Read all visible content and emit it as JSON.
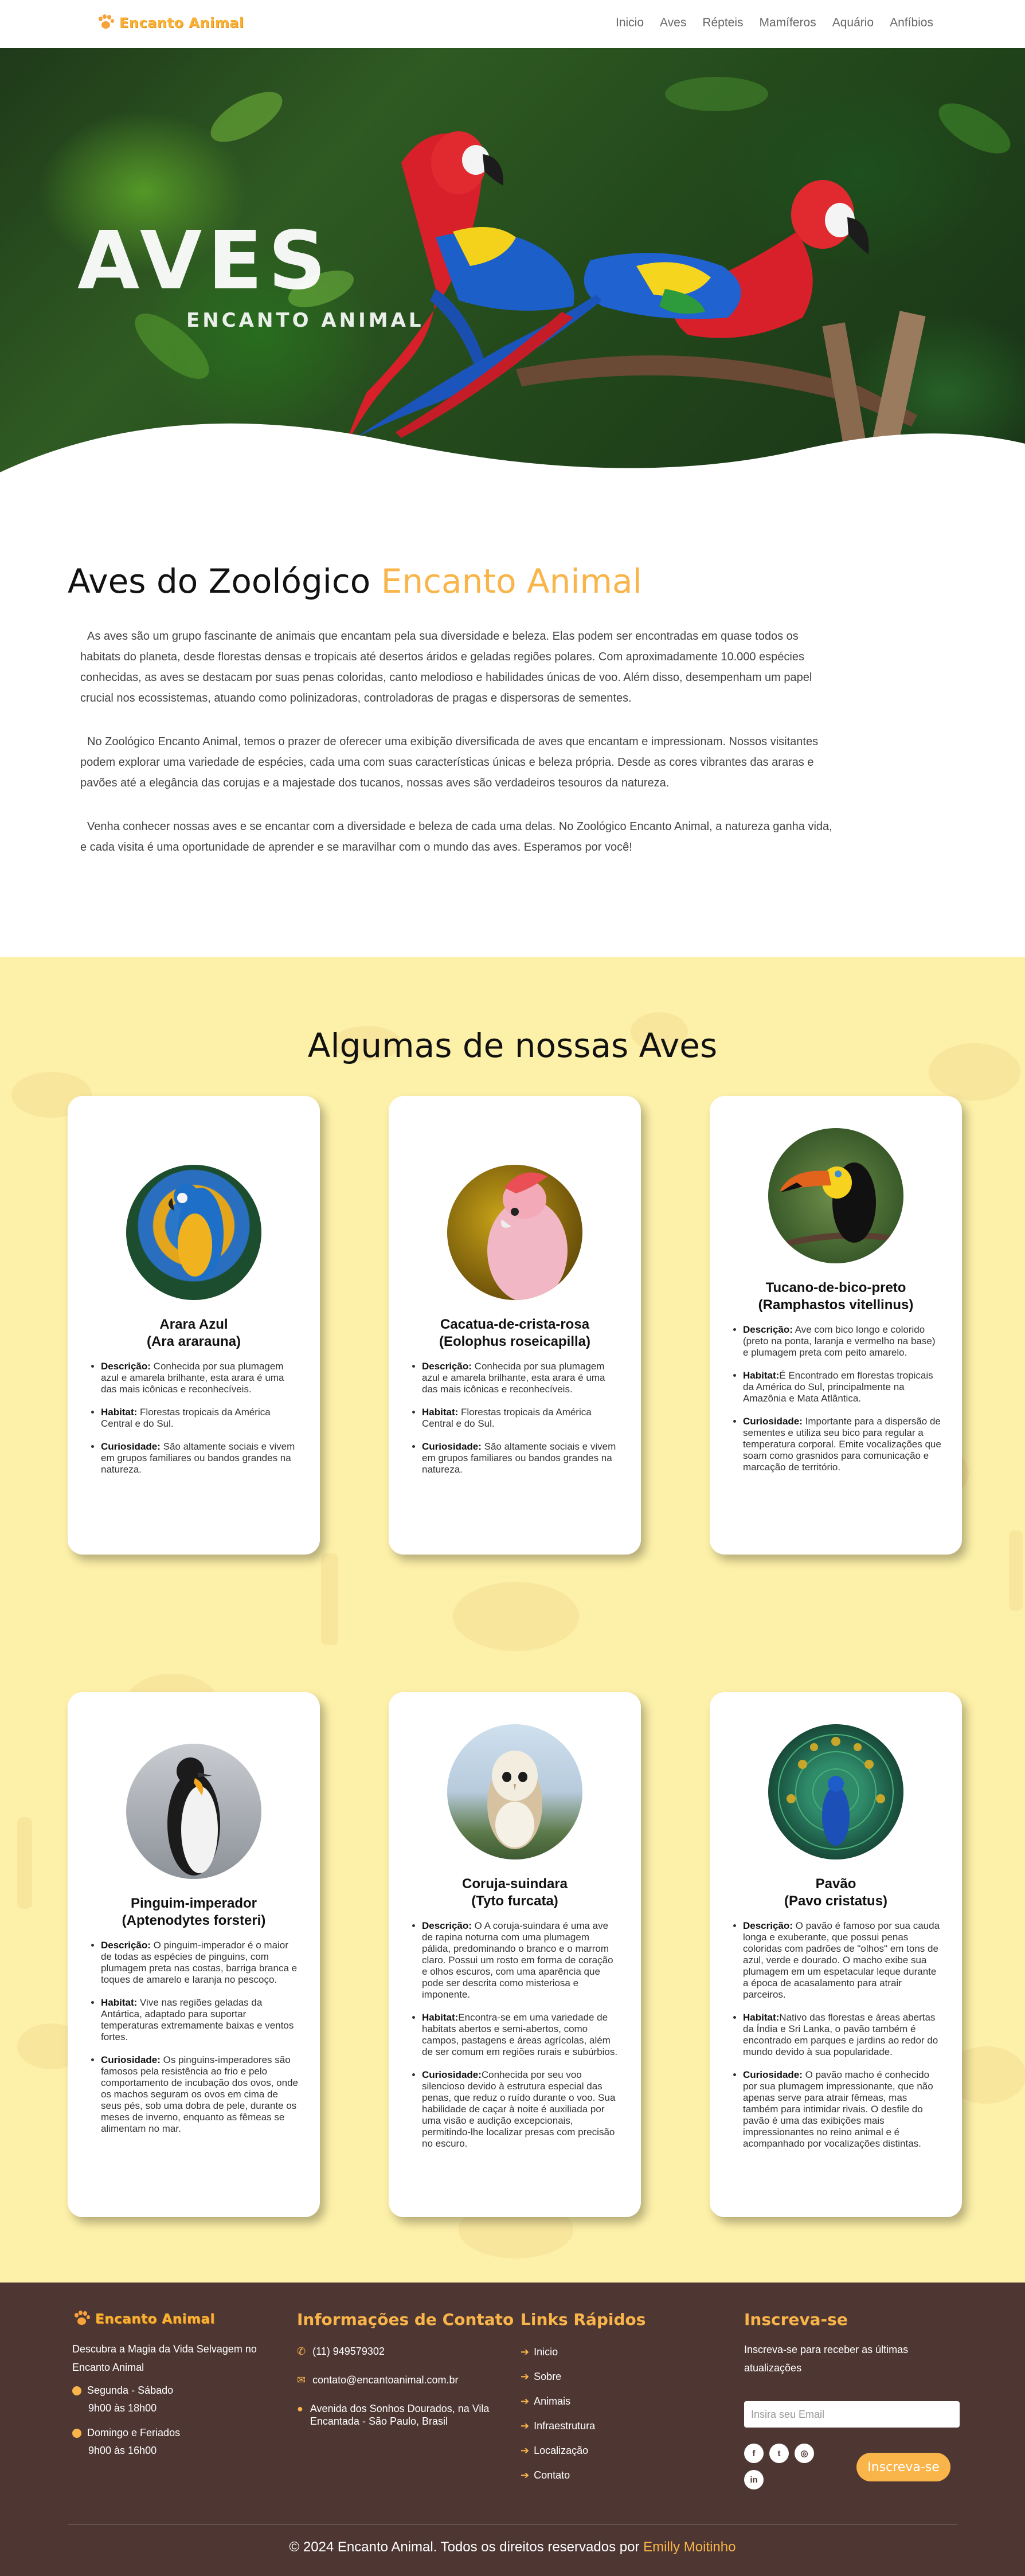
{
  "nav": {
    "brand": "Encanto Animal",
    "links": [
      "Inicio",
      "Aves",
      "Répteis",
      "Mamíferos",
      "Aquário",
      "Anfíbios"
    ]
  },
  "hero": {
    "title": "AVES",
    "subtitle": "ENCANTO ANIMAL"
  },
  "intro": {
    "title_main": "Aves do Zoológico ",
    "title_accent": "Encanto Animal",
    "paragraphs": [
      "As aves são um grupo fascinante de animais que encantam pela sua diversidade e beleza. Elas podem ser encontradas em quase todos os habitats do planeta, desde florestas densas e tropicais até desertos áridos e geladas regiões polares. Com aproximadamente 10.000 espécies conhecidas, as aves se destacam por suas penas coloridas, canto melodioso e habilidades únicas de voo. Além disso, desempenham um papel crucial nos ecossistemas, atuando como polinizadoras, controladoras de pragas e dispersoras de sementes.",
      "No Zoológico Encanto Animal, temos o prazer de oferecer uma exibição diversificada de aves que encantam e impressionam. Nossos visitantes podem explorar uma variedade de espécies, cada uma com suas características únicas e beleza própria. Desde as cores vibrantes das araras e pavões até a elegância das corujas e a majestade dos tucanos, nossas aves são verdadeiros tesouros da natureza.",
      "Venha conhecer nossas aves e se encantar com a diversidade e beleza de cada uma delas. No Zoológico Encanto Animal, a natureza ganha vida, e cada visita é uma oportunidade de aprender e se maravilhar com o mundo das aves. Esperamos por você!"
    ]
  },
  "birds_section": {
    "title": "Algumas de nossas Aves",
    "label_desc": "Descrição:",
    "label_habitat": "Habitat:",
    "label_curio": "Curiosidade:",
    "birds": [
      {
        "name": "Arara Azul",
        "scientific": "(Ara ararauna)",
        "description": " Conhecida por sua plumagem azul e amarela brilhante, esta arara é uma das mais icônicas e reconhecíveis.",
        "habitat": " Florestas tropicais da América Central e do Sul.",
        "curiosity": " São altamente sociais e vivem em grupos familiares ou bandos grandes na natureza."
      },
      {
        "name": "Cacatua-de-crista-rosa",
        "scientific": "(Eolophus roseicapilla)",
        "description": " Conhecida por sua plumagem azul e amarela brilhante, esta arara é uma das mais icônicas e reconhecíveis.",
        "habitat": " Florestas tropicais da América Central e do Sul.",
        "curiosity": " São altamente sociais e vivem em grupos familiares ou bandos grandes na natureza."
      },
      {
        "name": "Tucano-de-bico-preto",
        "scientific": "(Ramphastos vitellinus)",
        "description": " Ave com bico longo e colorido (preto na ponta, laranja e vermelho na base) e plumagem preta com peito amarelo.",
        "habitat": "É Encontrado em florestas tropicais da América do Sul, principalmente na Amazônia e Mata Atlântica.",
        "curiosity": " Importante para a dispersão de sementes e utiliza seu bico para regular a temperatura corporal. Emite vocalizações que soam como grasnidos para comunicação e marcação de território."
      },
      {
        "name": "Pinguim-imperador",
        "scientific": "(Aptenodytes forsteri)",
        "description": " O pinguim-imperador é o maior de todas as espécies de pinguins, com plumagem preta nas costas, barriga branca e toques de amarelo e laranja no pescoço.",
        "habitat": " Vive nas regiões geladas da Antártica, adaptado para suportar temperaturas extremamente baixas e ventos fortes.",
        "curiosity": " Os pinguins-imperadores são famosos pela resistência ao frio e pelo comportamento de incubação dos ovos, onde os machos seguram os ovos em cima de seus pés, sob uma dobra de pele, durante os meses de inverno, enquanto as fêmeas se alimentam no mar."
      },
      {
        "name": "Coruja-suindara",
        "scientific": "(Tyto furcata)",
        "description": " O A coruja-suindara é uma ave de rapina noturna com uma plumagem pálida, predominando o branco e o marrom claro. Possui um rosto em forma de coração e olhos escuros, com uma aparência que pode ser descrita como misteriosa e imponente.",
        "habitat": "Encontra-se em uma variedade de habitats abertos e semi-abertos, como campos, pastagens e áreas agrícolas, além de ser comum em regiões rurais e subúrbios.",
        "curiosity": "Conhecida por seu voo silencioso devido à estrutura especial das penas, que reduz o ruído durante o voo. Sua habilidade de caçar à noite é auxiliada por uma visão e audição excepcionais, permitindo-lhe localizar presas com precisão no escuro."
      },
      {
        "name": "Pavão",
        "scientific": "(Pavo cristatus)",
        "description": " O pavão é famoso por sua cauda longa e exuberante, que possui penas coloridas com padrões de \"olhos\" em tons de azul, verde e dourado. O macho exibe sua plumagem em um espetacular leque durante a época de acasalamento para atrair parceiros.",
        "habitat": "Nativo das florestas e áreas abertas da Índia e Sri Lanka, o pavão também é encontrado em parques e jardins ao redor do mundo devido à sua popularidade.",
        "curiosity": " O pavão macho é conhecido por sua plumagem impressionante, que não apenas serve para atrair fêmeas, mas também para intimidar rivais. O desfile do pavão é uma das exibições mais impressionantes no reino animal e é acompanhado por vocalizações distintas."
      }
    ]
  },
  "footer": {
    "brand": "Encanto Animal",
    "description": "Descubra a Magia da Vida Selvagem no Encanto Animal",
    "hours": [
      {
        "days": "Segunda - Sábado",
        "time": "9h00 às 18h00"
      },
      {
        "days": "Domingo e Feriados",
        "time": "9h00 às 16h00"
      }
    ],
    "contact_title": "Informações de Contato",
    "phone": "(11) 949579302",
    "email": "contato@encantoanimal.com.br",
    "address": "Avenida dos Sonhos Dourados, na Vila Encantada - São Paulo, Brasil",
    "links_title": "Links Rápidos",
    "links": [
      "Inicio",
      "Sobre",
      "Animais",
      "Infraestrutura",
      "Localização",
      "Contato"
    ],
    "subscribe_title": "Inscreva-se",
    "subscribe_text": "Inscreva-se para receber as últimas atualizações",
    "email_placeholder": "Insira seu Email",
    "subscribe_button": "Inscreva-se",
    "copyright_main": "© 2024 Encanto Animal. Todos os direitos reservados por ",
    "copyright_author": "Emilly Moitinho"
  },
  "colors": {
    "accent": "#f9b44a",
    "section_bg": "#fdf0a8",
    "footer_bg": "#4e3733"
  }
}
